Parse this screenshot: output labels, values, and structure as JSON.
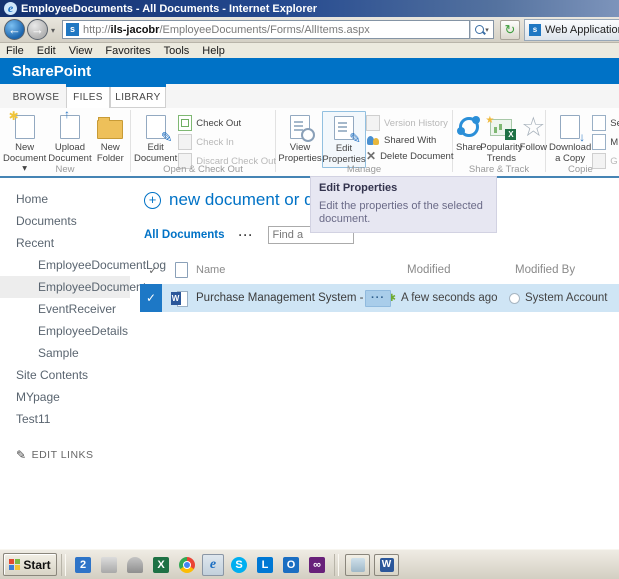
{
  "window": {
    "title": "EmployeeDocuments - All Documents - Internet Explorer"
  },
  "browser": {
    "url_protocol": "http://",
    "url_host": "ils-jacobr",
    "url_path": "/EmployeeDocuments/Forms/AllItems.aspx",
    "tab_title": "Web Applications Manag",
    "menu": {
      "file": "File",
      "edit": "Edit",
      "view": "View",
      "favorites": "Favorites",
      "tools": "Tools",
      "help": "Help"
    }
  },
  "suite_bar": {
    "brand": "SharePoint"
  },
  "ribbon": {
    "tabs": {
      "browse": "BROWSE",
      "files": "FILES",
      "library": "LIBRARY"
    },
    "new_group": {
      "label": "New",
      "new_document": "New Document",
      "dropdown": "▾",
      "upload_document": "Upload Document",
      "new_folder": "New Folder"
    },
    "open_group": {
      "label": "Open & Check Out",
      "edit_document": "Edit Document",
      "check_out": "Check Out",
      "check_in": "Check In",
      "discard_check_out": "Discard Check Out"
    },
    "manage_group": {
      "label": "Manage",
      "view_properties": "View Properties",
      "edit_properties": "Edit Properties",
      "version_history": "Version History",
      "shared_with": "Shared With",
      "delete_document": "Delete Document",
      "delete_x": "✕"
    },
    "share_group": {
      "label": "Share & Track",
      "share": "Share",
      "popularity_trends": "Popularity Trends",
      "follow": "Follow",
      "follow_star": "☆"
    },
    "copies_group": {
      "label": "Copie",
      "download_a_copy": "Download a Copy",
      "send_to": "Se",
      "manage_copies": "M",
      "go_to_source": "G"
    }
  },
  "tooltip": {
    "title": "Edit Properties",
    "body": "Edit the properties of the selected document."
  },
  "sidebar": {
    "items": [
      {
        "label": "Home"
      },
      {
        "label": "Documents"
      },
      {
        "label": "Recent"
      },
      {
        "label": "EmployeeDocumentLog"
      },
      {
        "label": "EmployeeDocuments"
      },
      {
        "label": "EventReceiver"
      },
      {
        "label": "EmployeeDetails"
      },
      {
        "label": "Sample"
      },
      {
        "label": "Site Contents"
      },
      {
        "label": "MYpage"
      },
      {
        "label": "Test11"
      },
      {
        "label": "EDIT LINKS"
      }
    ],
    "edit_links_pencil": "✎"
  },
  "main": {
    "new_document_heading": "new document or dr",
    "plus_glyph": "+",
    "view_label": "All Documents",
    "view_ellipsis": "···",
    "find_placeholder": "Find a"
  },
  "document_list": {
    "headers": {
      "check": "✓",
      "name": "Name",
      "modified": "Modified",
      "modified_by": "Modified By"
    },
    "row": {
      "check": "✓",
      "word_glyph": "W",
      "name": "Purchase Management System - RS",
      "new_badge": "✱",
      "ellipsis": "···",
      "modified": "A few seconds ago",
      "modified_by": "System Account"
    }
  },
  "icons": {
    "back_arrow": "←",
    "forward_arrow": "→",
    "caret_down": "▾",
    "refresh": "↻",
    "site_glyph": "s",
    "up_arrow": "↑",
    "down_arrow": "↓",
    "star_burst": "✱",
    "pencil": "✎"
  },
  "taskbar": {
    "start_label": "Start",
    "quick_launch": [
      {
        "name": "app-blue-icon",
        "glyph": "2"
      },
      {
        "name": "show-desktop-icon",
        "glyph": ""
      },
      {
        "name": "device-icon",
        "glyph": ""
      },
      {
        "name": "excel-icon",
        "glyph": "X"
      },
      {
        "name": "chrome-icon",
        "glyph": ""
      },
      {
        "name": "internet-explorer-icon",
        "glyph": "e"
      },
      {
        "name": "skype-icon",
        "glyph": "S"
      },
      {
        "name": "lync-icon",
        "glyph": "L"
      },
      {
        "name": "outlook-icon",
        "glyph": "O"
      },
      {
        "name": "visual-studio-icon",
        "glyph": "∞"
      }
    ],
    "window_buttons": [
      {
        "name": "minimized-window-button",
        "glyph": ""
      },
      {
        "name": "word-window-button",
        "glyph": "W"
      }
    ]
  },
  "colors": {
    "suite_blue": "#0072c6",
    "selection_blue": "#cfe5f5",
    "check_blue": "#1d78c6",
    "title_navy": "#14316f"
  }
}
